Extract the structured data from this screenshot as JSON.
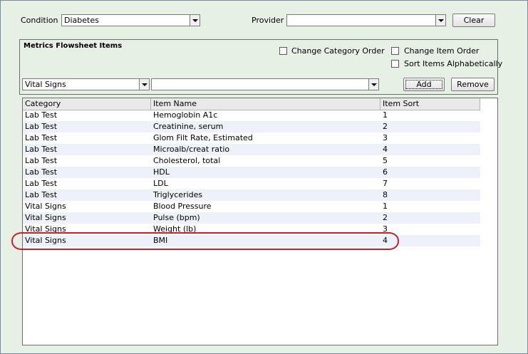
{
  "condition": {
    "label": "Condition",
    "value": "Diabetes"
  },
  "provider": {
    "label": "Provider",
    "value": ""
  },
  "clear_button": "Clear",
  "flowsheet": {
    "title": "Metrics Flowsheet Items",
    "change_category_order": "Change Category Order",
    "change_item_order": "Change Item Order",
    "sort_alpha": "Sort Items Alphabetically",
    "category_select": "Vital Signs",
    "item_select": "",
    "add_button": "Add",
    "remove_button": "Remove"
  },
  "grid": {
    "columns": [
      "Category",
      "Item Name",
      "Item Sort"
    ],
    "rows": [
      [
        "Lab Test",
        "Hemoglobin A1c",
        "1"
      ],
      [
        "Lab Test",
        "Creatinine, serum",
        "2"
      ],
      [
        "Lab Test",
        "Glom Filt Rate, Estimated",
        "3"
      ],
      [
        "Lab Test",
        "Microalb/creat ratio",
        "4"
      ],
      [
        "Lab Test",
        "Cholesterol, total",
        "5"
      ],
      [
        "Lab Test",
        "HDL",
        "6"
      ],
      [
        "Lab Test",
        "LDL",
        "7"
      ],
      [
        "Lab Test",
        "Triglycerides",
        "8"
      ],
      [
        "Vital Signs",
        "Blood Pressure",
        "1"
      ],
      [
        "Vital Signs",
        "Pulse (bpm)",
        "2"
      ],
      [
        "Vital Signs",
        "Weight (lb)",
        "3"
      ],
      [
        "Vital Signs",
        "BMI",
        "4"
      ]
    ]
  },
  "colors": {
    "background": "#e6f0e4",
    "alt_row": "#eef1fa",
    "highlight": "#c8202a"
  }
}
